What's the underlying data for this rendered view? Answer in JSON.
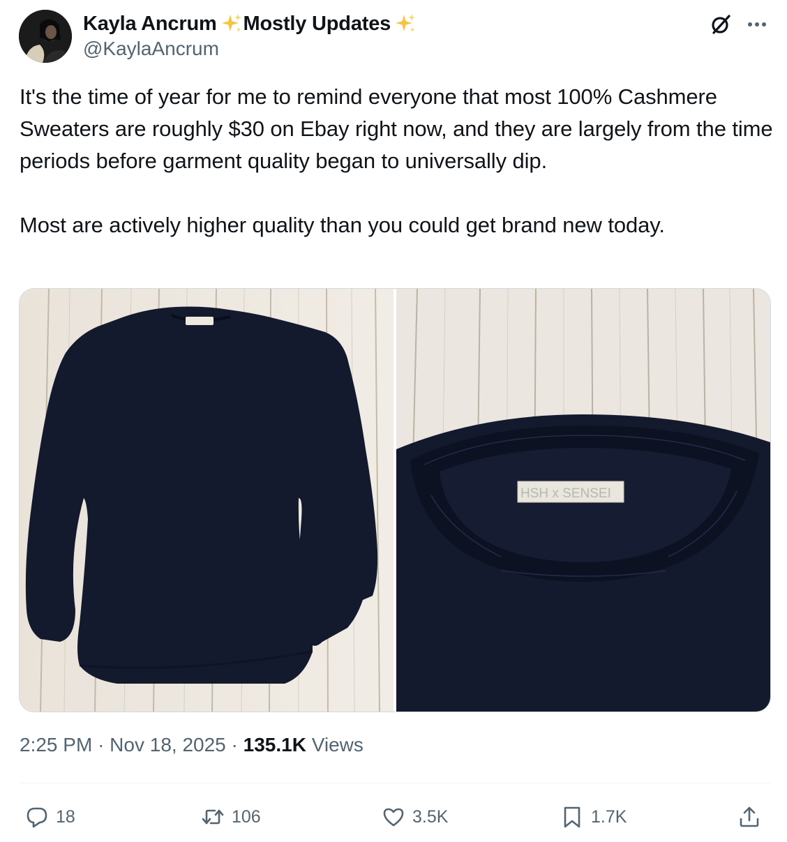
{
  "author": {
    "display_name": "Kayla Ancrum",
    "name_suffix": "Mostly Updates",
    "handle": "@KaylaAncrum"
  },
  "tweet": {
    "paragraphs": [
      "It's the time of year for me to remind everyone that most 100% Cashmere Sweaters are roughly $30 on Ebay right now, and they are largely from the time periods before garment quality began to universally dip.",
      "Most are actively higher quality than you could get brand new today."
    ]
  },
  "media": {
    "right_image_tag_text": "HSH x SENSEI"
  },
  "meta": {
    "time": "2:25 PM",
    "separator": "·",
    "date": "Nov 18, 2025",
    "views_count": "135.1K",
    "views_label": "Views"
  },
  "actions": {
    "replies": "18",
    "retweets": "106",
    "likes": "3.5K",
    "bookmarks": "1.7K"
  },
  "icons": {
    "sparkle": "sparkles-icon",
    "grok": "grok-icon",
    "more": "more-icon",
    "reply": "reply-icon",
    "retweet": "retweet-icon",
    "like": "heart-icon",
    "bookmark": "bookmark-icon",
    "share": "share-icon"
  },
  "colors": {
    "text_primary": "#0f1419",
    "text_secondary": "#536471",
    "sparkle": "#f5c542",
    "sweater": "#141a2e"
  }
}
